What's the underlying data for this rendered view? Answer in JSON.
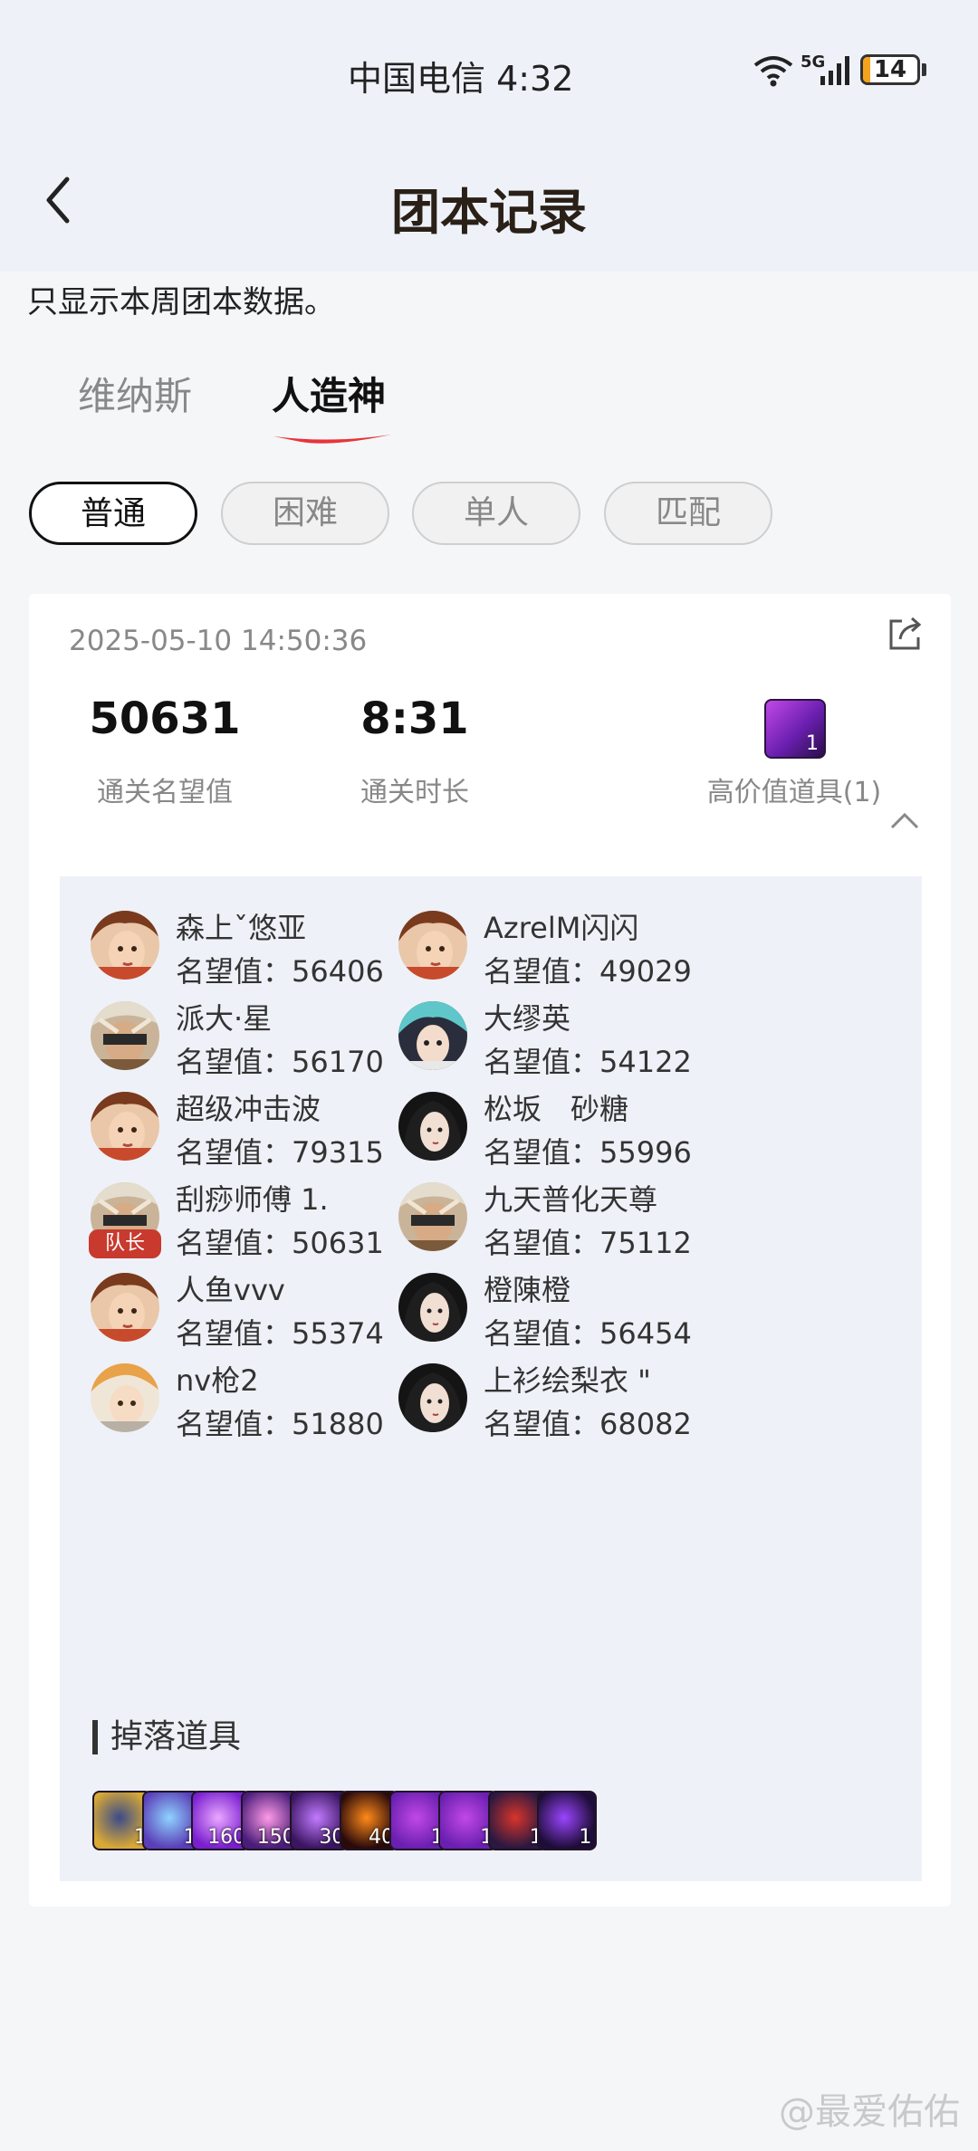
{
  "status_bar": {
    "carrier_time": "中国电信 4:32",
    "network": "5G",
    "battery": "14",
    "battery_level": 0.14
  },
  "header": {
    "title": "团本记录"
  },
  "notice": "只显示本周团本数据。",
  "tabs": [
    {
      "label": "维纳斯",
      "active": false
    },
    {
      "label": "人造神",
      "active": true
    }
  ],
  "filters": [
    {
      "label": "普通",
      "active": true
    },
    {
      "label": "困难",
      "active": false
    },
    {
      "label": "单人",
      "active": false
    },
    {
      "label": "匹配",
      "active": false
    }
  ],
  "record": {
    "datetime": "2025-05-10 14:50:36",
    "stats": [
      {
        "value": "50631",
        "label": "通关名望值"
      },
      {
        "value": "8:31",
        "label": "通关时长"
      }
    ],
    "high_value": {
      "label": "高价值道具(1)",
      "count": "1"
    },
    "players": [
      {
        "name": "森上ˇ悠亚",
        "fame": "名望值：56406",
        "avatar": "female-fighter-icon",
        "captain": false
      },
      {
        "name": "AzrelM闪闪",
        "fame": "名望值：49029",
        "avatar": "female-fighter-icon",
        "captain": false
      },
      {
        "name": "派大·星",
        "fame": "名望值：56170",
        "avatar": "masked-warrior-icon",
        "captain": false
      },
      {
        "name": "大缪英",
        "fame": "名望值：54122",
        "avatar": "teal-hair-gunner-icon",
        "captain": false
      },
      {
        "name": "超级冲击波",
        "fame": "名望值：79315",
        "avatar": "female-fighter-icon",
        "captain": false
      },
      {
        "name": "松坂　砂糖",
        "fame": "名望值：55996",
        "avatar": "dark-hair-mage-icon",
        "captain": false
      },
      {
        "name": "刮痧师傅 1.",
        "fame": "名望值：50631",
        "avatar": "masked-warrior-icon",
        "captain": true
      },
      {
        "name": "九天普化天尊",
        "fame": "名望值：75112",
        "avatar": "masked-warrior-icon",
        "captain": false
      },
      {
        "name": "人鱼vvv",
        "fame": "名望值：55374",
        "avatar": "female-fighter-icon",
        "captain": false
      },
      {
        "name": "橙陳橙",
        "fame": "名望值：56454",
        "avatar": "dark-hair-mage-icon",
        "captain": false
      },
      {
        "name": "nv枪2",
        "fame": "名望值：51880",
        "avatar": "blonde-gunner-icon",
        "captain": false
      },
      {
        "name": "上衫绘梨衣 \"",
        "fame": "名望值：68082",
        "avatar": "dark-hair-mage-icon",
        "captain": false
      }
    ],
    "captain_label": "队长",
    "drops_title": "掉落道具",
    "drops": [
      {
        "icon": "golden-armor-icon",
        "count": "1",
        "colors": [
          "#d9a935",
          "#3a4b8a"
        ]
      },
      {
        "icon": "crystal-blade-icon",
        "count": "1",
        "colors": [
          "#5a3fb8",
          "#8fd3ff"
        ]
      },
      {
        "icon": "purple-orb-icon",
        "count": "160",
        "colors": [
          "#7a1fd0",
          "#e9a8ff"
        ]
      },
      {
        "icon": "sparkle-shard-icon",
        "count": "150",
        "colors": [
          "#4a1d7a",
          "#ff9ae6"
        ]
      },
      {
        "icon": "void-swirl-icon",
        "count": "30",
        "colors": [
          "#3b1562",
          "#c27bff"
        ]
      },
      {
        "icon": "fire-eye-icon",
        "count": "40",
        "colors": [
          "#2a0a0a",
          "#ff8a1a"
        ]
      },
      {
        "icon": "purple-chest-icon",
        "count": "1",
        "colors": [
          "#6a1fb0",
          "#c248e6"
        ]
      },
      {
        "icon": "purple-chest-icon",
        "count": "1",
        "colors": [
          "#6a1fb0",
          "#c248e6"
        ]
      },
      {
        "icon": "red-box-icon",
        "count": "1",
        "colors": [
          "#2b1840",
          "#d8342b"
        ]
      },
      {
        "icon": "shadow-hook-icon",
        "count": "1",
        "colors": [
          "#1e0d38",
          "#9b45ff"
        ]
      }
    ]
  },
  "watermark": "@最爱佑佑"
}
